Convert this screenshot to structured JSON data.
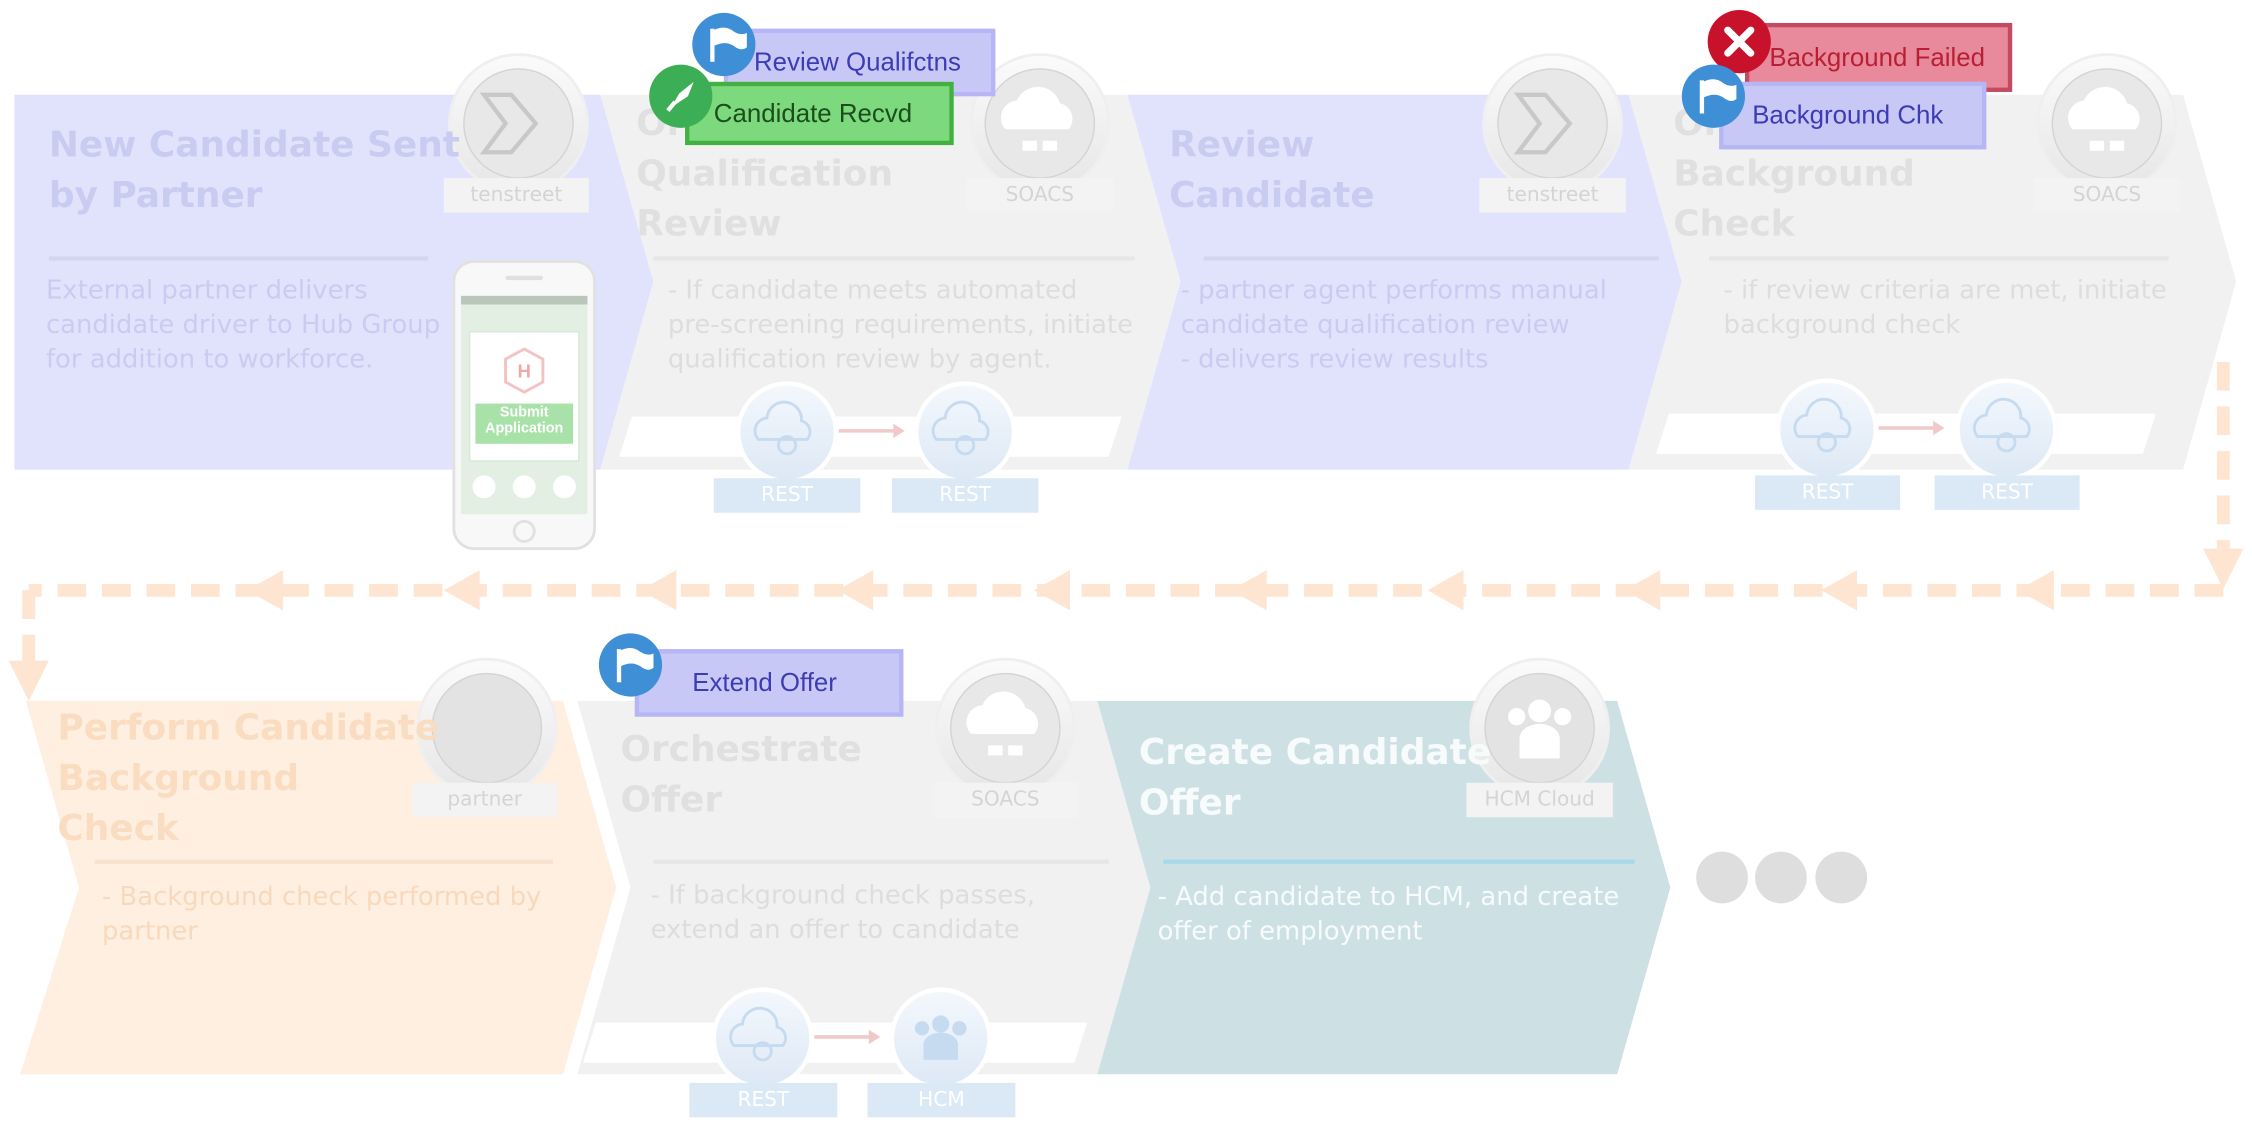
{
  "diagram": {
    "steps": [
      {
        "title": "New Candidate Sent\nby Partner",
        "description": "External partner delivers\ncandidate driver to Hub Group\nfor addition to workforce.",
        "system": "tenstreet"
      },
      {
        "title": "Or\nQualification\nReview",
        "description": "- If candidate meets automated\n pre-screening requirements, initiate\nqualification review by agent.",
        "system": "SOACS"
      },
      {
        "title": "Review\nCandidate",
        "description": "- partner agent performs manual\n candidate qualification review\n- delivers review results",
        "system": "tenstreet"
      },
      {
        "title": "Or\nBackground\nCheck",
        "description": "- if review criteria are met, initiate\n background  check",
        "system": "SOACS"
      },
      {
        "title": "Perform Candidate\nBackground\nCheck",
        "description": "- Background check performed by\npartner",
        "system": "partner"
      },
      {
        "title": "Orchestrate\nOffer",
        "description": "- If background check passes,\n extend an offer to candidate",
        "system": "SOACS"
      },
      {
        "title": "Create Candidate\nOffer",
        "description": " - Add candidate to HCM, and create\noffer of employment",
        "system": "HCM Cloud"
      }
    ],
    "connectors": [
      {
        "from": "REST",
        "to": "REST"
      },
      {
        "from": "REST",
        "to": "REST"
      },
      {
        "from": "REST",
        "to": "HCM"
      }
    ],
    "phone": {
      "button": "Submit\nApplication",
      "logo": "H"
    },
    "markers": [
      {
        "label": "Review Qualifctns",
        "status": "flag"
      },
      {
        "label": "Candidate Recvd",
        "status": "start"
      },
      {
        "label": "Background Failed",
        "status": "error"
      },
      {
        "label": "Background Chk",
        "status": "flag"
      },
      {
        "label": "Extend Offer",
        "status": "flag"
      }
    ]
  },
  "colors": {
    "partner_step": "#e1e3fc",
    "service_step": "#f1f1f1",
    "external_step": "#feefe0",
    "hcm_step": "#cde0e4",
    "flow_arrow": "#fde5d1",
    "flag_badge": "#3f8fd6",
    "start_badge": "#3cae55",
    "error_badge": "#c8112a",
    "continuation_dots": "#dedede"
  }
}
